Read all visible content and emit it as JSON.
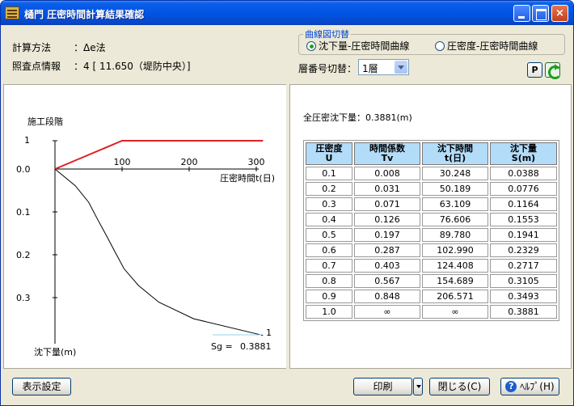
{
  "window": {
    "title": "樋門  圧密時間計算結果確認",
    "minimize": "",
    "maximize": "",
    "close": "×"
  },
  "info": {
    "calc_method_label": "計算方法",
    "calc_method_value": "：Δe法",
    "check_point_label": "照査点情報",
    "check_point_value": "：4 [ 11.650（堤防中央）]"
  },
  "curve_switch": {
    "legend": "曲線図切替",
    "option1": "沈下量-圧密時間曲線",
    "option2": "圧密度-圧密時間曲線",
    "selected": "option1"
  },
  "layer_switch": {
    "label": "層番号切替：",
    "value": "1層"
  },
  "toolbar": {
    "p_label": "P"
  },
  "chart_data": {
    "type": "line",
    "title": "",
    "stage_label": "施工段階",
    "xlabel": "圧密時間t(日)",
    "ylabel": "沈下量(m)",
    "x_ticks": [
      "100",
      "200",
      "300"
    ],
    "stage_ticks": [
      "1"
    ],
    "y_ticks": [
      "0.0",
      "0.1",
      "0.2",
      "0.3"
    ],
    "xlim": [
      0,
      300
    ],
    "ylim": [
      0,
      0.3881
    ],
    "stage_series": {
      "name": "施工段階",
      "color": "#dd2222",
      "x": [
        0,
        100,
        310
      ],
      "y": [
        0,
        1,
        1
      ]
    },
    "settlement_series": {
      "name": "沈下量",
      "color": "#000000",
      "x": [
        0,
        30.248,
        50.189,
        63.109,
        76.606,
        89.78,
        102.99,
        124.408,
        154.689,
        206.571,
        310
      ],
      "y": [
        0,
        0.0388,
        0.0776,
        0.1164,
        0.1553,
        0.1941,
        0.2329,
        0.2717,
        0.3105,
        0.3493,
        0.3881
      ]
    },
    "end_label": "1",
    "sg_label": "Sg = ",
    "sg_value": "0.3881"
  },
  "results": {
    "total_settlement": "全圧密沈下量：0.3881(m)",
    "headers": [
      [
        "圧密度",
        "U"
      ],
      [
        "時間係数",
        "Tv"
      ],
      [
        "沈下時間",
        "t(日)"
      ],
      [
        "沈下量",
        "S(m)"
      ]
    ],
    "rows": [
      [
        "0.1",
        "0.008",
        "30.248",
        "0.0388"
      ],
      [
        "0.2",
        "0.031",
        "50.189",
        "0.0776"
      ],
      [
        "0.3",
        "0.071",
        "63.109",
        "0.1164"
      ],
      [
        "0.4",
        "0.126",
        "76.606",
        "0.1553"
      ],
      [
        "0.5",
        "0.197",
        "89.780",
        "0.1941"
      ],
      [
        "0.6",
        "0.287",
        "102.990",
        "0.2329"
      ],
      [
        "0.7",
        "0.403",
        "124.408",
        "0.2717"
      ],
      [
        "0.8",
        "0.567",
        "154.689",
        "0.3105"
      ],
      [
        "0.9",
        "0.848",
        "206.571",
        "0.3493"
      ],
      [
        "1.0",
        "∞",
        "∞",
        "0.3881"
      ]
    ]
  },
  "buttons": {
    "display_settings": "表示設定",
    "print": "印刷",
    "close": "閉じる(C)",
    "help": "ﾍﾙﾌﾟ(H)",
    "help_glyph": "?"
  }
}
